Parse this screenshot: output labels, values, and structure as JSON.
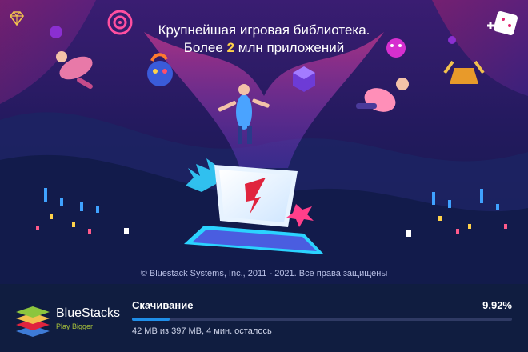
{
  "hero": {
    "headline_line1": "Крупнейшая игровая библиотека.",
    "headline_line2_prefix": "Более ",
    "headline_line2_accent": "2",
    "headline_line2_suffix": " млн приложений",
    "copyright": "© Bluestack Systems, Inc., 2011 - 2021. Все права защищены",
    "colors": {
      "accent": "#ffd24a",
      "sky": "#2a1d6b",
      "magenta": "#e0246e"
    }
  },
  "icons": {
    "left": "diamond-icon",
    "right": "gamepad-dice-icon"
  },
  "brand": {
    "name": "BlueStacks",
    "tagline": "Play Bigger"
  },
  "download": {
    "label": "Скачивание",
    "percent": "9,92%",
    "progress": 0.0992,
    "detail": "42 MB из 397 MB, 4 мин. осталось",
    "bar_color": "#1f8ee8"
  }
}
